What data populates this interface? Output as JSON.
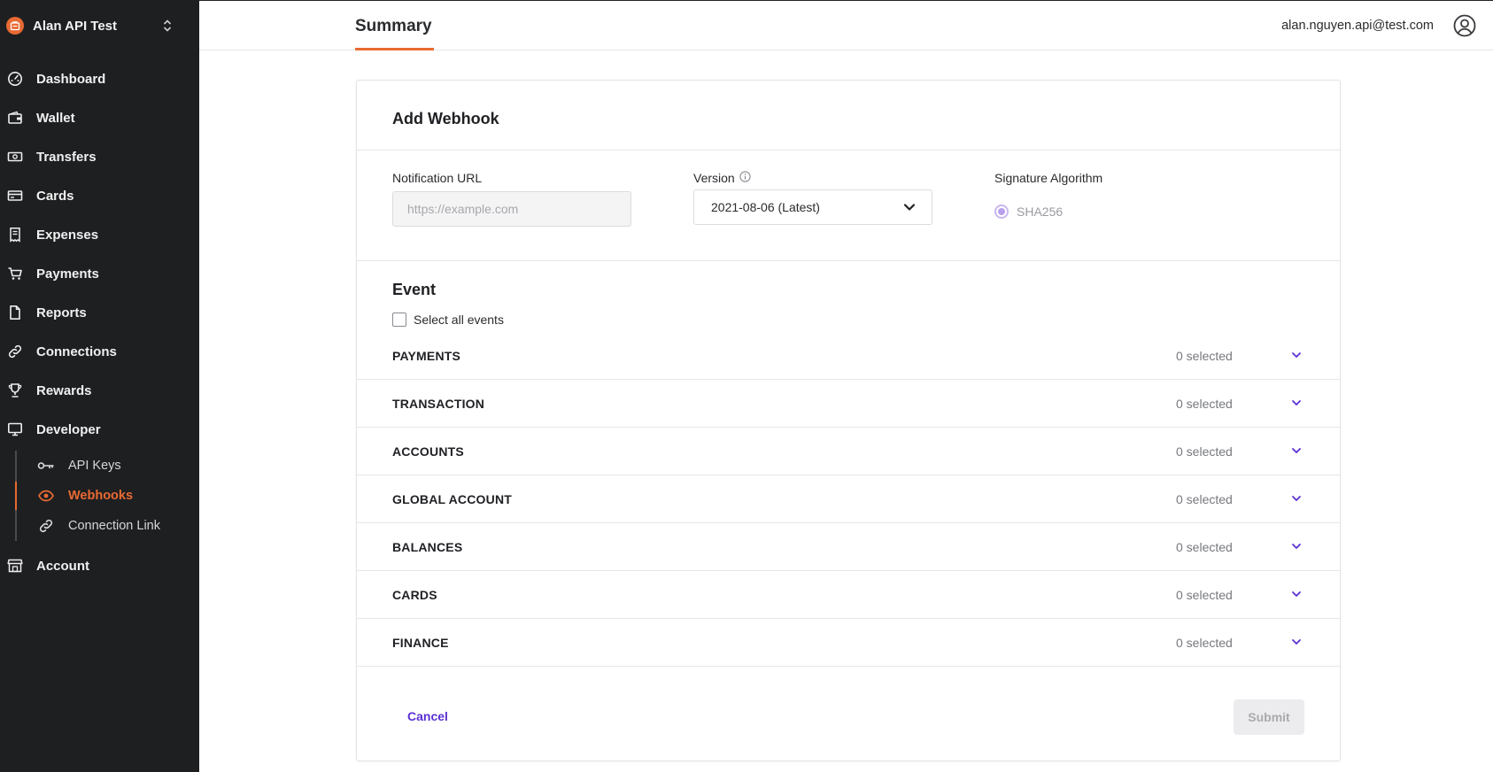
{
  "sidebar": {
    "org_name": "Alan API Test",
    "items": [
      {
        "label": "Dashboard",
        "icon": "dashboard-gauge-icon"
      },
      {
        "label": "Wallet",
        "icon": "wallet-icon"
      },
      {
        "label": "Transfers",
        "icon": "transfers-money-icon"
      },
      {
        "label": "Cards",
        "icon": "card-icon"
      },
      {
        "label": "Expenses",
        "icon": "receipt-icon"
      },
      {
        "label": "Payments",
        "icon": "cart-icon"
      },
      {
        "label": "Reports",
        "icon": "document-icon"
      },
      {
        "label": "Connections",
        "icon": "link-icon"
      },
      {
        "label": "Rewards",
        "icon": "trophy-icon"
      },
      {
        "label": "Developer",
        "icon": "monitor-icon"
      },
      {
        "label": "Account",
        "icon": "store-icon"
      }
    ],
    "developer_sub": [
      {
        "label": "API Keys",
        "icon": "key-icon",
        "active": false
      },
      {
        "label": "Webhooks",
        "icon": "eye-icon",
        "active": true
      },
      {
        "label": "Connection Link",
        "icon": "link-icon",
        "active": false
      }
    ]
  },
  "header": {
    "tab": "Summary",
    "user_email": "alan.nguyen.api@test.com"
  },
  "form": {
    "title": "Add Webhook",
    "url_label": "Notification URL",
    "url_placeholder": "https://example.com",
    "url_value": "",
    "version_label": "Version",
    "version_value": "2021-08-06 (Latest)",
    "signature_label": "Signature Algorithm",
    "signature_value": "SHA256",
    "event_title": "Event",
    "select_all_label": "Select all events",
    "events": [
      {
        "name": "PAYMENTS",
        "count": "0 selected"
      },
      {
        "name": "TRANSACTION",
        "count": "0 selected"
      },
      {
        "name": "ACCOUNTS",
        "count": "0 selected"
      },
      {
        "name": "GLOBAL ACCOUNT",
        "count": "0 selected"
      },
      {
        "name": "BALANCES",
        "count": "0 selected"
      },
      {
        "name": "CARDS",
        "count": "0 selected"
      },
      {
        "name": "FINANCE",
        "count": "0 selected"
      }
    ],
    "cancel_label": "Cancel",
    "submit_label": "Submit"
  },
  "colors": {
    "accent": "#e86a33",
    "link": "#5b2fd3",
    "sidebar_bg": "#1e1f21"
  }
}
